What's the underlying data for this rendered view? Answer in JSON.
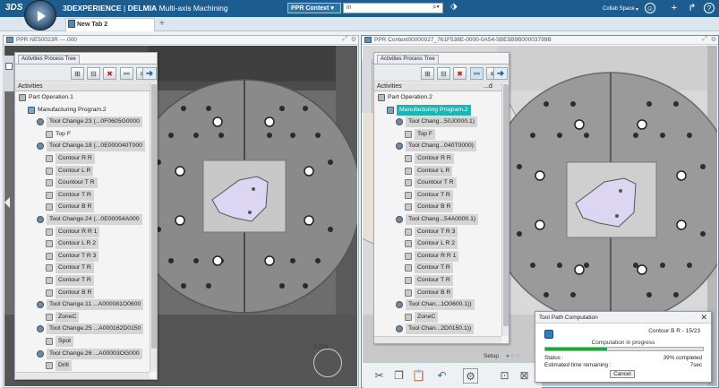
{
  "app": {
    "brand": "3DEXPERIENCE",
    "separator": " | ",
    "product": "DELMIA",
    "module": " Multi-axis Machining"
  },
  "toolbar": {
    "context_dropdown": "PPR Context",
    "search_value": "in",
    "collab_space": "Collab Space"
  },
  "tabs": [
    {
      "label": "New Tab 2"
    }
  ],
  "viewers": [
    {
      "title": "PPR NE50023R ---.000",
      "panel_tab": "Activities Process Tree",
      "column_header": "Activities",
      "tree": [
        {
          "label": "Part Operation.1",
          "type": "part",
          "level": 0
        },
        {
          "label": "Manufacturing Program.2",
          "type": "prog",
          "level": 1
        },
        {
          "label": "Tool Change.23 (...0F0605G0000",
          "type": "tool",
          "level": 2,
          "style": "grey"
        },
        {
          "label": "Top F",
          "type": "op",
          "level": 3
        },
        {
          "label": "Tool Change.18 (...0E000040T000",
          "type": "tool",
          "level": 2,
          "style": "grey"
        },
        {
          "label": "Contour R R",
          "type": "op",
          "level": 3,
          "style": "grey"
        },
        {
          "label": "Contour L R",
          "type": "op",
          "level": 3,
          "style": "grey"
        },
        {
          "label": "Countour T R",
          "type": "op",
          "level": 3,
          "style": "grey"
        },
        {
          "label": "Contour T R",
          "type": "op",
          "level": 3,
          "style": "grey"
        },
        {
          "label": "Contour B R",
          "type": "op",
          "level": 3,
          "style": "grey"
        },
        {
          "label": "Tool Change.24 (...0E00054A000",
          "type": "tool",
          "level": 2,
          "style": "grey"
        },
        {
          "label": "Contour R R 1",
          "type": "op",
          "level": 3,
          "style": "grey"
        },
        {
          "label": "Contour L R 2",
          "type": "op",
          "level": 3,
          "style": "grey"
        },
        {
          "label": "Contour T R 3",
          "type": "op",
          "level": 3,
          "style": "grey"
        },
        {
          "label": "Contour T R",
          "type": "op",
          "level": 3,
          "style": "grey"
        },
        {
          "label": "Contour T R",
          "type": "op",
          "level": 3,
          "style": "grey"
        },
        {
          "label": "Contour B R",
          "type": "op",
          "level": 3,
          "style": "grey"
        },
        {
          "label": "Tool Change.11 ...A000081O0600",
          "type": "tool",
          "level": 2,
          "style": "grey"
        },
        {
          "label": "ZoneC",
          "type": "op",
          "level": 3,
          "style": "grey"
        },
        {
          "label": "Tool Change.25 ...A000162D0150",
          "type": "tool",
          "level": 2,
          "style": "grey"
        },
        {
          "label": "Spot",
          "type": "op",
          "level": 3,
          "style": "grey"
        },
        {
          "label": "Tool Change.26 ...A00003OG000",
          "type": "tool",
          "level": 2,
          "style": "grey"
        },
        {
          "label": "Drill",
          "type": "op",
          "level": 3,
          "style": "grey"
        }
      ]
    },
    {
      "title": "PPR Context00000027_761F538E-0000-0A54-5BE5B9B00003799B",
      "panel_tab": "Activities Process Tree",
      "column_header": "Activities",
      "column_header_2": "...d",
      "tree": [
        {
          "label": "Part Operation.2",
          "type": "part",
          "level": 0
        },
        {
          "label": "Manufacturing Program.2",
          "type": "prog",
          "level": 1,
          "style": "sel"
        },
        {
          "label": "Tool Chang...50J0000.1)",
          "type": "tool",
          "level": 2,
          "style": "grey"
        },
        {
          "label": "Top F",
          "type": "op",
          "level": 3,
          "style": "grey"
        },
        {
          "label": "Tool Chang...040T0000)",
          "type": "tool",
          "level": 2,
          "style": "grey"
        },
        {
          "label": "Contour R R",
          "type": "op",
          "level": 3,
          "style": "grey"
        },
        {
          "label": "Contour L R",
          "type": "op",
          "level": 3,
          "style": "grey"
        },
        {
          "label": "Countour T R",
          "type": "op",
          "level": 3,
          "style": "grey"
        },
        {
          "label": "Contour T R",
          "type": "op",
          "level": 3,
          "style": "grey"
        },
        {
          "label": "Contour B R",
          "type": "op",
          "level": 3,
          "style": "grey"
        },
        {
          "label": "Tool Chang...54A0000.1)",
          "type": "tool",
          "level": 2,
          "style": "grey"
        },
        {
          "label": "Contour T R 3",
          "type": "op",
          "level": 3,
          "style": "grey"
        },
        {
          "label": "Contour L R 2",
          "type": "op",
          "level": 3,
          "style": "grey"
        },
        {
          "label": "Contour R R 1",
          "type": "op",
          "level": 3,
          "style": "grey"
        },
        {
          "label": "Contour T R",
          "type": "op",
          "level": 3,
          "style": "grey"
        },
        {
          "label": "Contour T R",
          "type": "op",
          "level": 3,
          "style": "grey"
        },
        {
          "label": "Contour B R",
          "type": "op",
          "level": 3,
          "style": "grey"
        },
        {
          "label": "Tool Chan...1O0600.1))",
          "type": "tool",
          "level": 2,
          "style": "grey"
        },
        {
          "label": "ZoneC",
          "type": "op",
          "level": 3,
          "style": "grey"
        },
        {
          "label": "Tool Chan...2D0150.1))",
          "type": "tool",
          "level": 2,
          "style": "grey"
        }
      ]
    }
  ],
  "compute_dialog": {
    "title": "Tool Path Computation",
    "operation": "Contour B R - 15/23",
    "progress_label": "Computation in progress",
    "progress_fraction": 0.39,
    "status_label": "Status :",
    "status_value": "39% completed",
    "remaining_label": "Estimated time remaining :",
    "remaining_value": "7sec",
    "cancel_label": "Cancel"
  },
  "bottom": {
    "setup_label": "Setup"
  },
  "viewport": {
    "zoom_readout": "0.229"
  },
  "colors": {
    "topbar": "#1c5c8f",
    "selection": "#1ab5b5",
    "progress": "#1fa83a"
  }
}
